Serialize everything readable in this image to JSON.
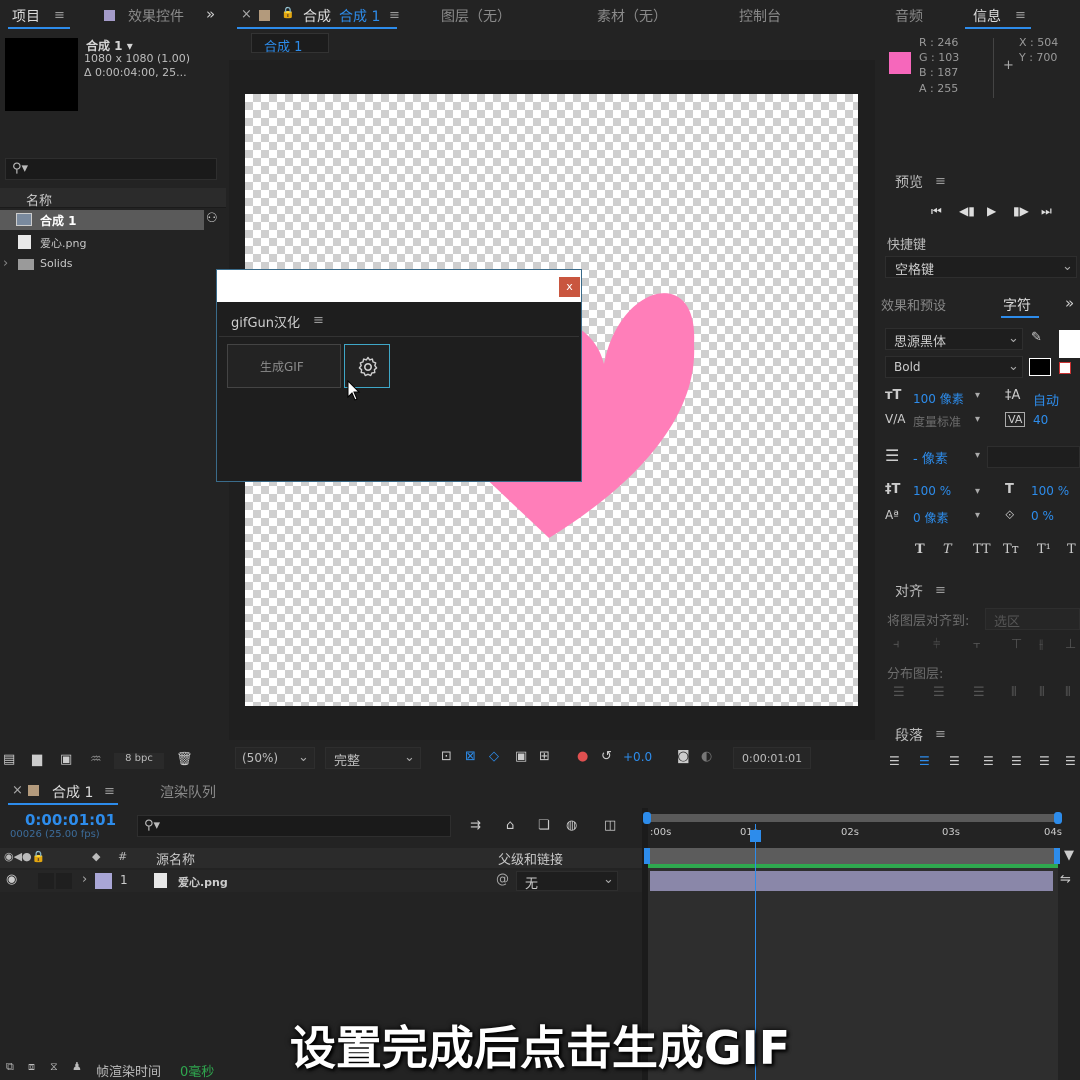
{
  "project": {
    "tab_project": "项目",
    "tab_effects": "效果控件",
    "comp_name": "合成 1",
    "comp_size": "1080 x 1080 (1.00)",
    "comp_duration": "Δ 0:00:04:00, 25...",
    "col_name": "名称",
    "items": [
      "合成 1",
      "爱心.png",
      "Solids"
    ],
    "bpc": "8 bpc"
  },
  "viewer": {
    "tab_comp": "合成",
    "tab_comp_active": "合成 1",
    "tab_layer": "图层（无）",
    "tab_footage": "素材（无）",
    "tab_console": "控制台",
    "sub_tab": "合成 1",
    "zoom": "(50%)",
    "quality": "完整",
    "exposure": "+0.0",
    "timecode": "0:00:01:01"
  },
  "plugin": {
    "title": "gifGun汉化",
    "generate_label": "生成GIF",
    "close": "x"
  },
  "info": {
    "tab_audio": "音频",
    "tab_info": "信息",
    "r": "R : 246",
    "g": "G : 103",
    "b": "B : 187",
    "a": "A :  255",
    "x": "X : 504",
    "y": "Y : 700",
    "swatch": "#f667bb"
  },
  "preview": {
    "title": "预览",
    "shortcut_label": "快捷键",
    "shortcut_value": "空格键"
  },
  "character": {
    "tab_effects": "效果和预设",
    "tab_char": "字符",
    "font": "思源黑体",
    "style": "Bold",
    "size": "100 像素",
    "leading": "自动",
    "kerning": "度量标准",
    "tracking": "40",
    "stroke": "- 像素",
    "vscale": "100 %",
    "hscale": "100 %",
    "baseline": "0 像素",
    "tsume": "0 %"
  },
  "align": {
    "title": "对齐",
    "align_to": "将图层对齐到:",
    "align_to_value": "选区",
    "distribute": "分布图层:"
  },
  "paragraph": {
    "title": "段落"
  },
  "timeline": {
    "tab_comp": "合成 1",
    "tab_render": "渲染队列",
    "timecode": "0:00:01:01",
    "frames": "00026 (25.00 fps)",
    "col_source": "源名称",
    "col_parent": "父级和链接",
    "layer_num": "1",
    "layer_name": "爱心.png",
    "parent_value": "无",
    "ruler": [
      ":00s",
      "01s",
      "02s",
      "03s",
      "04s"
    ],
    "render_time_label": "帧渲染时间",
    "render_time_value": "0毫秒"
  },
  "caption": "设置完成后点击生成GIF"
}
